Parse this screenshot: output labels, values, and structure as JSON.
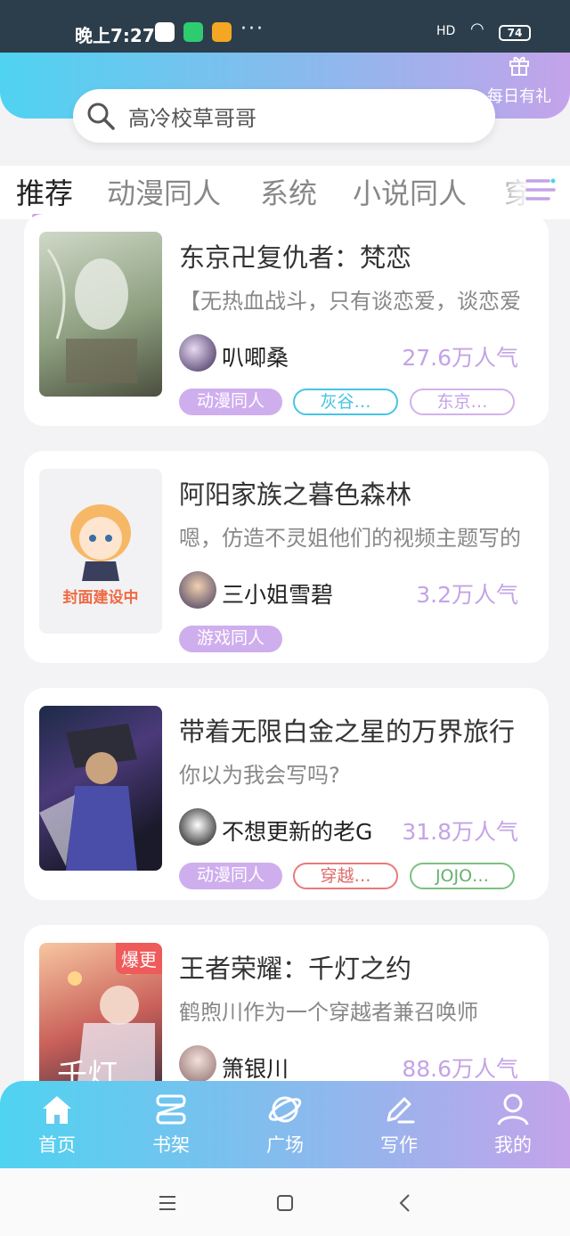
{
  "status_bar": {
    "time": "晚上7:27",
    "dots": "···",
    "signal": "HD",
    "battery": "74"
  },
  "header": {
    "gift_label": "每日有礼",
    "search_text": "高冷校草哥哥"
  },
  "tabs": [
    "推荐",
    "动漫同人",
    "系统",
    "小说同人",
    "穿越"
  ],
  "books": [
    {
      "title": "东京卍复仇者：梵恋",
      "desc": "【无热血战斗，只有谈恋爱，谈恋爱",
      "author": "叭唧桑",
      "popularity": "27.6万人气",
      "tags": [
        "动漫同人",
        "灰谷…",
        "东京…"
      ]
    },
    {
      "title": "阿阳家族之暮色森林",
      "desc": "嗯，仿造不灵姐他们的视频主题写的",
      "author": "三小姐雪碧",
      "popularity": "3.2万人气",
      "tags": [
        "游戏同人"
      ],
      "cover_text": "封面建设中"
    },
    {
      "title": "带着无限白金之星的万界旅行",
      "desc": "你以为我会写吗?",
      "author": "不想更新的老G",
      "popularity": "31.8万人气",
      "tags": [
        "动漫同人",
        "穿越…",
        "JOJO…"
      ]
    },
    {
      "title": "王者荣耀：千灯之约",
      "desc": "鹤煦川作为一个穿越者兼召唤师",
      "author": "箫银川",
      "popularity": "88.6万人气",
      "tags": [],
      "badge": "爆更"
    }
  ],
  "bottom_nav": [
    "首页",
    "书架",
    "广场",
    "写作",
    "我的"
  ],
  "colors": {
    "accent_purple": "#c4a3e6",
    "gradient_start": "#4fd3f0",
    "gradient_end": "#c4a3ea",
    "status_bar": "#2c3e4b"
  }
}
